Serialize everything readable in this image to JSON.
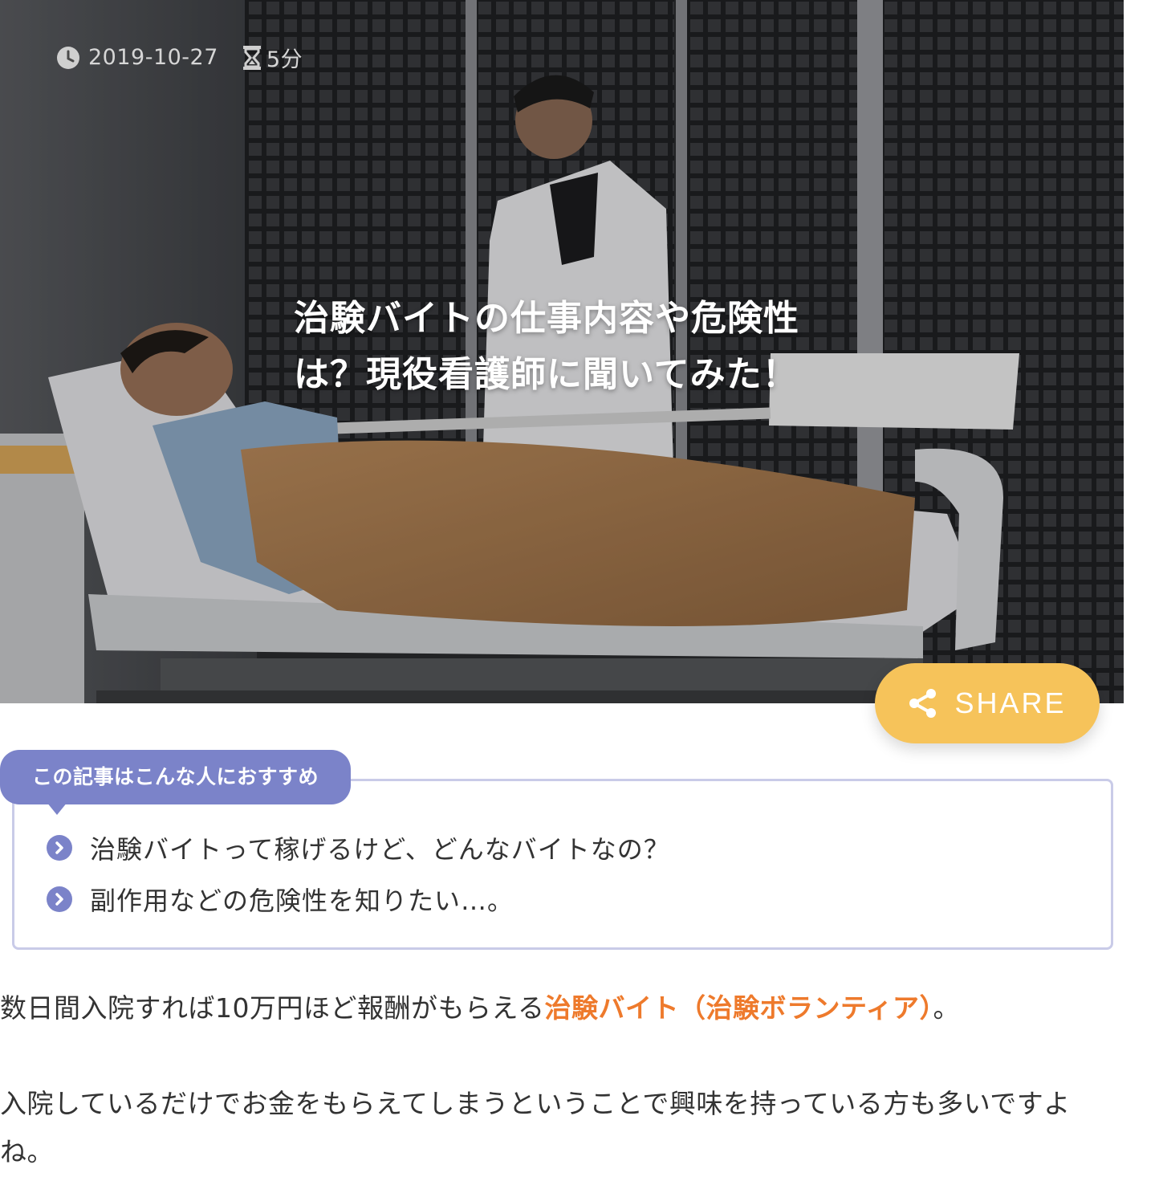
{
  "hero": {
    "date": "2019-10-27",
    "read_time": "5分",
    "title_line1": "治験バイトの仕事内容や危険性",
    "title_line2": "は？現役看護師に聞いてみた！"
  },
  "share": {
    "label": "SHARE"
  },
  "recommend": {
    "heading": "この記事はこんな人におすすめ",
    "items": [
      "治験バイトって稼げるけど、どんなバイトなの？",
      "副作用などの危険性を知りたい…。"
    ]
  },
  "body": {
    "p1_before": "数日間入院すれば10万円ほど報酬がもらえる",
    "p1_highlight": "治験バイト（治験ボランティア）",
    "p1_after": "。",
    "p2": "入院しているだけでお金をもらえてしまうということで興味を持っている方も多いですよね。"
  },
  "colors": {
    "share_button": "#f6c35a",
    "recommend_accent": "#7b83c9",
    "recommend_border": "#c9cbe8",
    "highlight_text": "#ee7a2c"
  },
  "icons": {
    "date": "clock-icon",
    "read_time": "hourglass-icon",
    "share": "share-icon",
    "list_bullet": "chevron-right-circle-icon"
  }
}
